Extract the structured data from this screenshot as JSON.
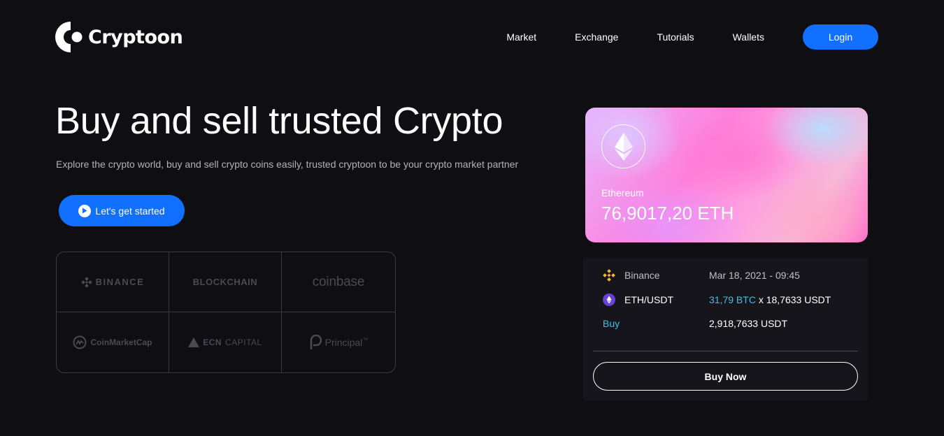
{
  "header": {
    "logo_text": "Cryptoon",
    "nav": [
      "Market",
      "Exchange",
      "Tutorials",
      "Wallets"
    ],
    "login_label": "Login"
  },
  "hero": {
    "title": "Buy and sell trusted Crypto",
    "subtitle": "Explore the crypto world, buy and sell crypto coins easily, trusted cryptoon to be your crypto market partner",
    "cta_label": "Let's get started"
  },
  "partners": {
    "binance": "BINANCE",
    "blockchain": "BLOCKCHAIN",
    "coinbase": "coinbase",
    "coinmarketcap": "CoinMarketCap",
    "ecn_bold": "ECN",
    "ecn_rest": "CAPITAL",
    "principal": "Principal",
    "principal_tm": "™"
  },
  "card": {
    "coin_name": "Ethereum",
    "amount": "76,9017,20 ETH"
  },
  "trade": {
    "exchange": "Binance",
    "datetime": "Mar 18, 2021 - 09:45",
    "pair": "ETH/USDT",
    "rate_btc": "31,79 BTC",
    "rate_rest": " x 18,7633 USDT",
    "side": "Buy",
    "total": "2,918,7633 USDT",
    "buy_label": "Buy Now"
  },
  "colors": {
    "accent": "#1170ff",
    "background": "#0f0e13",
    "panel": "#16151b",
    "binance_gold": "#f3ba2f",
    "eth_purple": "#6a3fd6",
    "cyan": "#3fc1e0"
  }
}
